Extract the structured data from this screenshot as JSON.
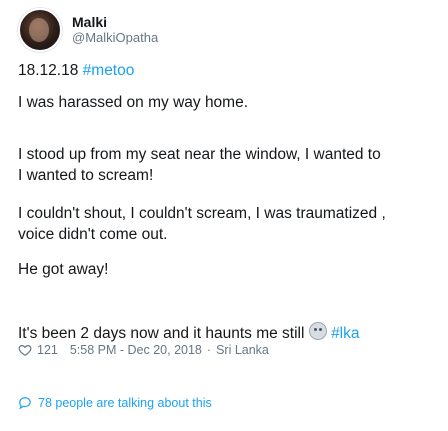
{
  "user": {
    "display_name": "Malki",
    "handle": "@MalkiOpatha"
  },
  "tweet": {
    "date_text": "18.12.18",
    "hashtag_metoo": "#metoo",
    "line1": "I was harassed on my way home.",
    "line2a": "I stood up from my seat near the window, I wanted to",
    "line2b": "I wanted to scream!",
    "line3a": "I couldn't shout, I couldn't scream, I was traumatized ,",
    "line3b": "voice didn't come out.",
    "line4": "He got away!",
    "line5": "It's been 2 days now and it haunts me still",
    "hashtag_lka": "#lka",
    "emoji": "worried-face"
  },
  "meta": {
    "likes": "121",
    "timestamp": "5:58 PM - Dec 20, 2018",
    "separator": "·",
    "location": "Sri Lanka"
  },
  "footer": {
    "talking_text": "78 people are talking about this"
  },
  "colors": {
    "link": "#1da1f2",
    "muted": "#657786",
    "text": "#14171a"
  }
}
